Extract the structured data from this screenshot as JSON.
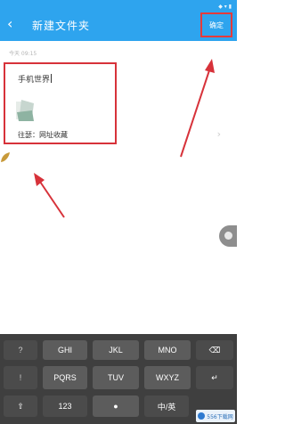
{
  "header": {
    "back_icon": "chevron-left-icon",
    "title": "新建文件夹",
    "save_label": "确定",
    "status_text": "◆ ▾ ▮"
  },
  "note": {
    "time_text": "今天 09:15",
    "text": "手机世界",
    "source_label": "往瑟：网址收藏"
  },
  "keyboard": {
    "rows": [
      [
        "?",
        "GHI",
        "JKL",
        "MNO",
        "⌫"
      ],
      [
        "!",
        "PQRS",
        "TUV",
        "WXYZ",
        "↵"
      ],
      [
        "⇧",
        "123",
        "🎤",
        "中/英"
      ]
    ]
  },
  "watermark": "556下载网",
  "colors": {
    "accent": "#2ea4ee",
    "highlight": "#d7323a",
    "keyboard_bg": "#3f3f3f"
  }
}
